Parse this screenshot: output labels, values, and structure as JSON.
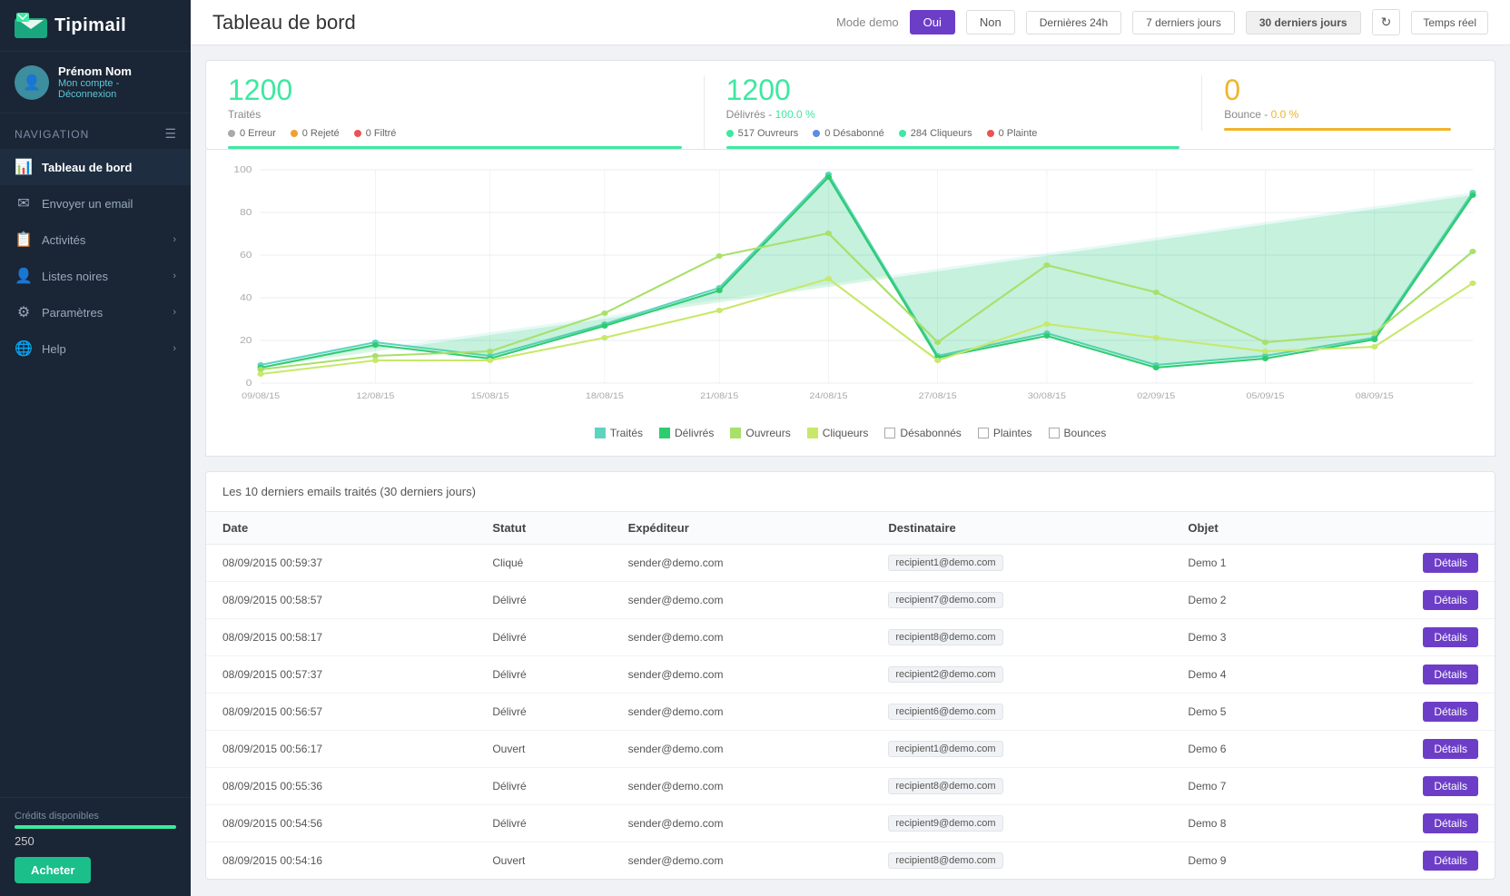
{
  "sidebar": {
    "logo": "Tipimail",
    "user": {
      "name": "Prénom Nom",
      "link": "Mon compte - Déconnexion"
    },
    "nav_title": "Navigation",
    "items": [
      {
        "id": "dashboard",
        "label": "Tableau de bord",
        "icon": "📊",
        "active": true,
        "arrow": false
      },
      {
        "id": "send-email",
        "label": "Envoyer un email",
        "icon": "✉",
        "active": false,
        "arrow": false
      },
      {
        "id": "activities",
        "label": "Activités",
        "icon": "📋",
        "active": false,
        "arrow": true
      },
      {
        "id": "blacklists",
        "label": "Listes noires",
        "icon": "👤",
        "active": false,
        "arrow": true
      },
      {
        "id": "settings",
        "label": "Paramètres",
        "icon": "⚙",
        "active": false,
        "arrow": true
      },
      {
        "id": "help",
        "label": "Help",
        "icon": "🌐",
        "active": false,
        "arrow": true
      }
    ],
    "credits": {
      "label": "Crédits disponibles",
      "percent": "100%",
      "count": "250"
    },
    "buy_label": "Acheter"
  },
  "header": {
    "title": "Tableau de bord",
    "mode_demo_label": "Mode demo",
    "oui_label": "Oui",
    "non_label": "Non",
    "time_buttons": [
      "Dernières 24h",
      "7 derniers jours",
      "30 derniers jours"
    ],
    "active_time": "30 derniers jours",
    "realtime_label": "Temps réel"
  },
  "stats": {
    "block1": {
      "number": "1200",
      "label": "Traités",
      "details": [
        {
          "color": "gray",
          "text": "0 Erreur"
        },
        {
          "color": "orange",
          "text": "0 Rejeté"
        },
        {
          "color": "red",
          "text": "0 Filtré"
        }
      ]
    },
    "block2": {
      "number": "1200",
      "label": "Délivrés",
      "sublabel": "100.0 %",
      "details": [
        {
          "color": "green-bright",
          "text": "517 Ouvreurs"
        },
        {
          "color": "blue",
          "text": "0 Désabonné"
        },
        {
          "color": "green-bright",
          "text": "284 Cliqueurs"
        },
        {
          "color": "red2",
          "text": "0 Plainte"
        }
      ]
    },
    "block3": {
      "number": "0",
      "label": "Bounce",
      "sublabel": "0.0 %"
    }
  },
  "chart": {
    "x_labels": [
      "09/08/15",
      "12/08/15",
      "15/08/15",
      "18/08/15",
      "21/08/15",
      "24/08/15",
      "27/08/15",
      "30/08/15",
      "02/09/15",
      "05/09/15",
      "08/09/15"
    ],
    "legend": [
      {
        "id": "traites",
        "label": "Traités",
        "color": "filled-teal"
      },
      {
        "id": "delivres",
        "label": "Délivrés",
        "color": "filled-green"
      },
      {
        "id": "ouvreurs",
        "label": "Ouvreurs",
        "color": "filled-lightgreen"
      },
      {
        "id": "cliqueurs",
        "label": "Cliqueurs",
        "color": "filled-lime"
      },
      {
        "id": "desabonnes",
        "label": "Désabonnés",
        "color": "empty"
      },
      {
        "id": "plaintes",
        "label": "Plaintes",
        "color": "empty"
      },
      {
        "id": "bounces",
        "label": "Bounces",
        "color": "empty"
      }
    ]
  },
  "table": {
    "title": "Les 10 derniers emails traités (30 derniers jours)",
    "columns": [
      "Date",
      "Statut",
      "Expéditeur",
      "Destinataire",
      "Objet",
      ""
    ],
    "rows": [
      {
        "date": "08/09/2015 00:59:37",
        "statut": "Cliqué",
        "from": "sender@demo.com",
        "to": "recipient1@demo.com",
        "subject": "Demo 1"
      },
      {
        "date": "08/09/2015 00:58:57",
        "statut": "Délivré",
        "from": "sender@demo.com",
        "to": "recipient7@demo.com",
        "subject": "Demo 2"
      },
      {
        "date": "08/09/2015 00:58:17",
        "statut": "Délivré",
        "from": "sender@demo.com",
        "to": "recipient8@demo.com",
        "subject": "Demo 3"
      },
      {
        "date": "08/09/2015 00:57:37",
        "statut": "Délivré",
        "from": "sender@demo.com",
        "to": "recipient2@demo.com",
        "subject": "Demo 4"
      },
      {
        "date": "08/09/2015 00:56:57",
        "statut": "Délivré",
        "from": "sender@demo.com",
        "to": "recipient6@demo.com",
        "subject": "Demo 5"
      },
      {
        "date": "08/09/2015 00:56:17",
        "statut": "Ouvert",
        "from": "sender@demo.com",
        "to": "recipient1@demo.com",
        "subject": "Demo 6"
      },
      {
        "date": "08/09/2015 00:55:36",
        "statut": "Délivré",
        "from": "sender@demo.com",
        "to": "recipient8@demo.com",
        "subject": "Demo 7"
      },
      {
        "date": "08/09/2015 00:54:56",
        "statut": "Délivré",
        "from": "sender@demo.com",
        "to": "recipient9@demo.com",
        "subject": "Demo 8"
      },
      {
        "date": "08/09/2015 00:54:16",
        "statut": "Ouvert",
        "from": "sender@demo.com",
        "to": "recipient8@demo.com",
        "subject": "Demo 9"
      }
    ],
    "details_label": "Détails"
  }
}
